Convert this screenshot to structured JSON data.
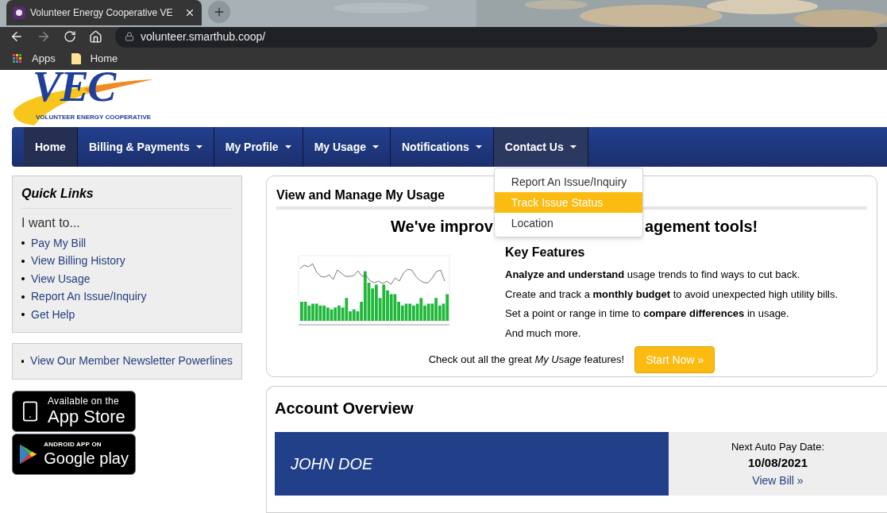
{
  "browser": {
    "tab_title": "Volunteer Energy Cooperative VE",
    "url": "volunteer.smarthub.coop/",
    "bookmarks": [
      {
        "label": "Apps",
        "kind": "apps"
      },
      {
        "label": "Home",
        "kind": "folder"
      }
    ]
  },
  "logo": {
    "initials": "VEC",
    "name": "VOLUNTEER ENERGY COOPERATIVE"
  },
  "nav": [
    {
      "label": "Home",
      "selected": true,
      "expanded": false,
      "dropdown": false
    },
    {
      "label": "Billing & Payments",
      "selected": false,
      "expanded": false,
      "dropdown": true
    },
    {
      "label": "My Profile",
      "selected": false,
      "expanded": false,
      "dropdown": true
    },
    {
      "label": "My Usage",
      "selected": false,
      "expanded": false,
      "dropdown": true
    },
    {
      "label": "Notifications",
      "selected": false,
      "expanded": false,
      "dropdown": true
    },
    {
      "label": "Contact Us",
      "selected": false,
      "expanded": true,
      "dropdown": true
    }
  ],
  "contact_menu": [
    {
      "label": "Report An Issue/Inquiry",
      "selected": false
    },
    {
      "label": "Track Issue Status",
      "selected": true
    },
    {
      "label": "Location",
      "selected": false
    }
  ],
  "quick_links": {
    "title": "Quick Links",
    "subtitle": "I want to...",
    "links": [
      "Pay My Bill",
      "View Billing History",
      "View Usage",
      "Report An Issue/Inquiry",
      "Get Help"
    ]
  },
  "newsletter": [
    "View Our Member Newsletter Powerlines"
  ],
  "app_badges": [
    {
      "kind": "apple",
      "small": "Available on the",
      "big": "App Store"
    },
    {
      "kind": "google",
      "small": "ANDROID APP ON",
      "big": "Google play"
    }
  ],
  "usage": {
    "title": "View and Manage My Usage",
    "heading_parts": [
      "We've improv",
      "agement tools!"
    ],
    "features_title": "Key Features",
    "features": [
      "**Analyze and understand** usage trends to find ways to cut back.",
      "Create and track a **monthly budget** to avoid unexpected high utility bills.",
      "Set a point or range in time to **compare differences** in usage.",
      "And much more."
    ],
    "promo": "Check out all the great *My Usage* features!",
    "button": "Start Now »"
  },
  "account": {
    "title": "Account Overview",
    "name": "JOHN DOE",
    "label": "Next Auto Pay Date:",
    "date": "10/08/2021",
    "link": "View Bill »"
  }
}
